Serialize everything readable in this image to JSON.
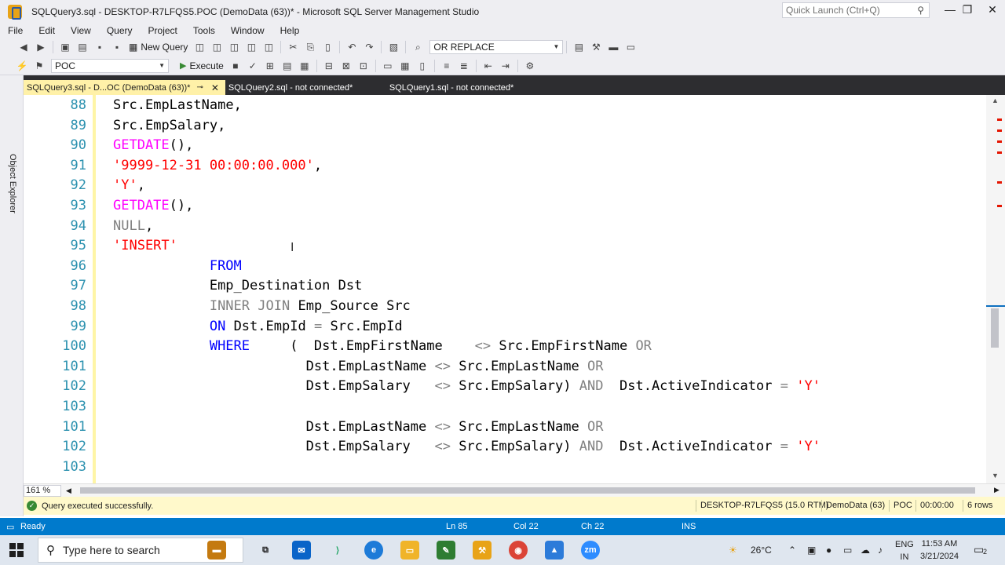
{
  "window": {
    "title": "SQLQuery3.sql - DESKTOP-R7LFQS5.POC (DemoData (63))* - Microsoft SQL Server Management Studio",
    "quick_launch_placeholder": "Quick Launch (Ctrl+Q)"
  },
  "menu": [
    "File",
    "Edit",
    "View",
    "Query",
    "Project",
    "Tools",
    "Window",
    "Help"
  ],
  "toolbar": {
    "new_query_label": "New Query",
    "replace_dropdown": "OR REPLACE",
    "database_dropdown": "POC",
    "execute_label": "Execute"
  },
  "side_panel": {
    "object_explorer_label": "Object Explorer"
  },
  "tabs": [
    {
      "label": "SQLQuery3.sql - D...OC (DemoData (63))*",
      "active": true
    },
    {
      "label": "SQLQuery2.sql - not connected*",
      "active": false
    },
    {
      "label": "SQLQuery1.sql - not connected*",
      "active": false
    }
  ],
  "editor": {
    "lines": [
      {
        "num": "88",
        "code": "Src.EmpLastName,"
      },
      {
        "num": "89",
        "code": "Src.EmpSalary,"
      },
      {
        "num": "90",
        "code": "GETDATE(),"
      },
      {
        "num": "91",
        "code": "'9999-12-31 00:00:00.000',"
      },
      {
        "num": "92",
        "code": "'Y',"
      },
      {
        "num": "93",
        "code": "GETDATE(),"
      },
      {
        "num": "94",
        "code": "NULL,"
      },
      {
        "num": "95",
        "code": "'INSERT'"
      },
      {
        "num": "96",
        "code": "            FROM"
      },
      {
        "num": "97",
        "code": "            Emp_Destination Dst"
      },
      {
        "num": "98",
        "code": "            INNER JOIN Emp_Source Src"
      },
      {
        "num": "99",
        "code": "            ON Dst.EmpId = Src.EmpId"
      },
      {
        "num": "100",
        "code": "            WHERE     (  Dst.EmpFirstName    <> Src.EmpFirstName OR"
      },
      {
        "num": "101",
        "code": "                        Dst.EmpLastName <> Src.EmpLastName OR"
      },
      {
        "num": "102",
        "code": "                        Dst.EmpSalary   <> Src.EmpSalary) AND  Dst.ActiveIndicator = 'Y'"
      },
      {
        "num": "103",
        "code": ""
      },
      {
        "num": "101",
        "code": "                        Dst.EmpLastName <> Src.EmpLastName OR"
      },
      {
        "num": "102",
        "code": "                        Dst.EmpSalary   <> Src.EmpSalary) AND  Dst.ActiveIndicator = 'Y'"
      },
      {
        "num": "103",
        "code": ""
      }
    ]
  },
  "zoom": "161 %",
  "query_status": {
    "message": "Query executed successfully.",
    "server": "DESKTOP-R7LFQS5 (15.0 RTM)",
    "database": "DemoData (63)",
    "login": "POC",
    "elapsed": "00:00:00",
    "rows": "6 rows"
  },
  "status_bar": {
    "ready": "Ready",
    "ln": "Ln 85",
    "col": "Col 22",
    "ch": "Ch 22",
    "mode": "INS"
  },
  "taskbar": {
    "search_placeholder": "Type here to search",
    "weather": "26°C",
    "language": "ENG",
    "region": "IN",
    "time": "11:53 AM",
    "date": "3/21/2024",
    "notification_count": "2"
  },
  "colors": {
    "keyword": "#0000ff",
    "function": "#ff00ff",
    "string": "#ff0000",
    "line_number": "#2b91af",
    "status_bar": "#007acc",
    "active_tab": "#fff1a8",
    "query_status_bg": "#fff9cb"
  }
}
